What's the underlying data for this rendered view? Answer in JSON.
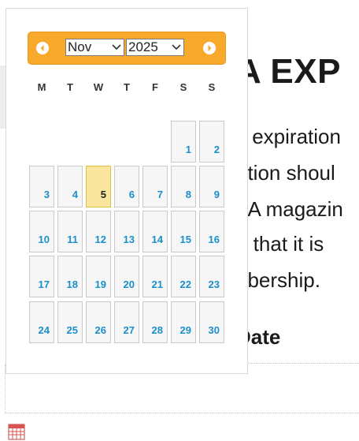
{
  "background": {
    "title_fragment": "A EXP",
    "lines": [
      "y expiration",
      "ation shoul",
      "2A magazin",
      "e that it is",
      "nbership."
    ],
    "date_label": "Date"
  },
  "datepicker": {
    "month": "Nov",
    "year": "2025",
    "weekday_labels": [
      "M",
      "T",
      "W",
      "T",
      "F",
      "S",
      "S"
    ],
    "weeks": [
      [
        "",
        "",
        "",
        "",
        "",
        "1",
        "2"
      ],
      [
        "3",
        "4",
        "5",
        "6",
        "7",
        "8",
        "9"
      ],
      [
        "10",
        "11",
        "12",
        "13",
        "14",
        "15",
        "16"
      ],
      [
        "17",
        "18",
        "19",
        "20",
        "21",
        "22",
        "23"
      ],
      [
        "24",
        "25",
        "26",
        "27",
        "28",
        "29",
        "30"
      ]
    ],
    "today": "5",
    "colors": {
      "header": "#f7a92c",
      "day_text": "#1a8fc9",
      "today_bg": "#fbe6a0"
    }
  },
  "icons": {
    "prev": "chevron-left-icon",
    "next": "chevron-right-icon",
    "calendar": "calendar-icon"
  }
}
